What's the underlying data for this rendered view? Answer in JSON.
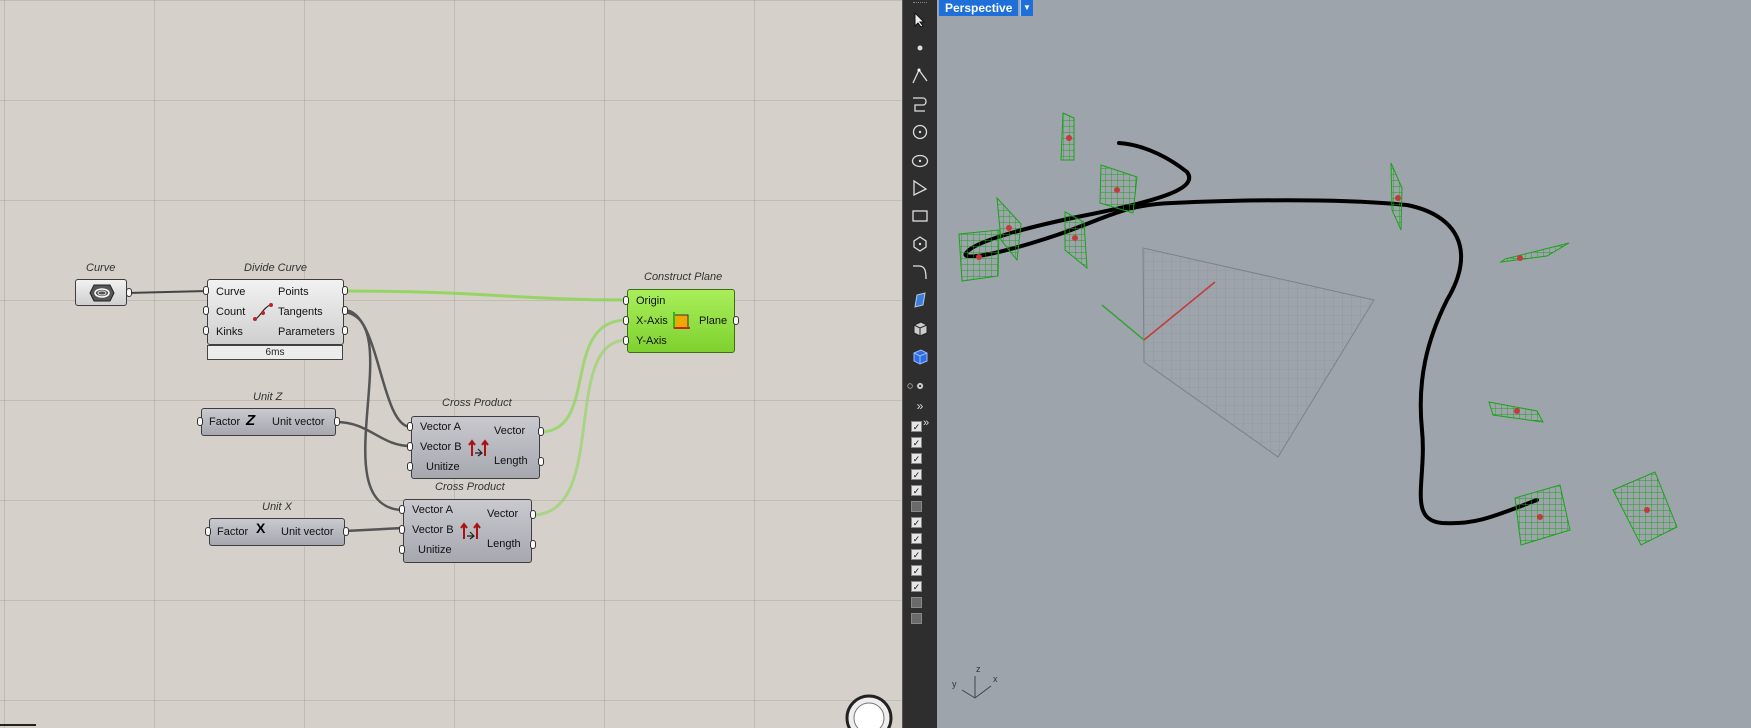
{
  "canvas": {
    "components": {
      "curve": {
        "title": "Curve"
      },
      "divide_curve": {
        "title": "Divide Curve",
        "inputs": [
          "Curve",
          "Count",
          "Kinks"
        ],
        "outputs": [
          "Points",
          "Tangents",
          "Parameters"
        ],
        "timer": "6ms"
      },
      "construct_plane": {
        "title": "Construct Plane",
        "inputs": [
          "Origin",
          "X-Axis",
          "Y-Axis"
        ],
        "outputs": [
          "Plane"
        ]
      },
      "unit_z": {
        "title": "Unit Z",
        "input": "Factor",
        "output": "Unit vector",
        "icon_letter": "Z"
      },
      "unit_x": {
        "title": "Unit X",
        "input": "Factor",
        "output": "Unit vector",
        "icon_letter": "X"
      },
      "cross_product_1": {
        "title": "Cross Product",
        "inputs": [
          "Vector A",
          "Vector B",
          "Unitize"
        ],
        "outputs": [
          "Vector",
          "Length"
        ]
      },
      "cross_product_2": {
        "title": "Cross Product",
        "inputs": [
          "Vector A",
          "Vector B",
          "Unitize"
        ],
        "outputs": [
          "Vector",
          "Length"
        ]
      }
    }
  },
  "toolbar": {
    "tools": [
      "select-arrow-icon",
      "point-icon",
      "polyline-icon",
      "curve-icon",
      "circle-icon",
      "ellipse-icon",
      "arc-icon",
      "rectangle-icon",
      "polygon-icon",
      "fillet-icon",
      "gumball-icon",
      "solid-icon",
      "box-icon"
    ],
    "checkboxes": [
      true,
      true,
      true,
      true,
      true,
      false,
      true,
      true,
      true,
      true,
      true,
      false,
      false
    ]
  },
  "viewport": {
    "label": "Perspective",
    "axes": {
      "x": "x",
      "y": "y",
      "z": "z"
    },
    "colors": {
      "background": "#9ea4ab",
      "plane_mesh": "#19a319",
      "curve": "#000000",
      "x_axis": "#c43a3a",
      "y_axis": "#3aa13a"
    }
  }
}
